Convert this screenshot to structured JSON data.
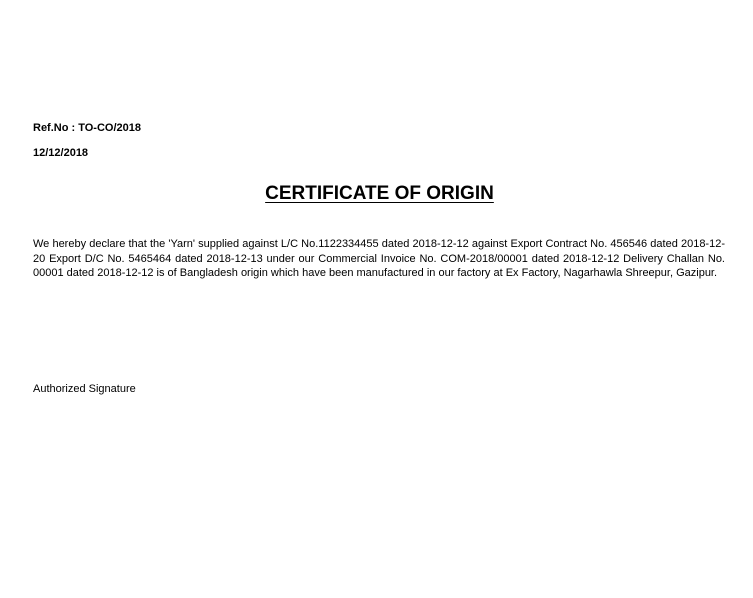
{
  "document": {
    "ref_no": "Ref.No : TO-CO/2018",
    "date": "12/12/2018",
    "title": "CERTIFICATE OF ORIGIN",
    "declaration": "We hereby declare that the 'Yarn' supplied against L/C No.1122334455 dated 2018-12-12 against Export Contract No. 456546 dated 2018-12-20 Export D/C No. 5465464 dated 2018-12-13 under our Commercial Invoice No. COM-2018/00001 dated 2018-12-12 Delivery Challan No. 00001 dated 2018-12-12 is of Bangladesh origin which have been manufactured in our factory at Ex Factory, Nagarhawla Shreepur, Gazipur.",
    "signature_label": "Authorized Signature"
  }
}
